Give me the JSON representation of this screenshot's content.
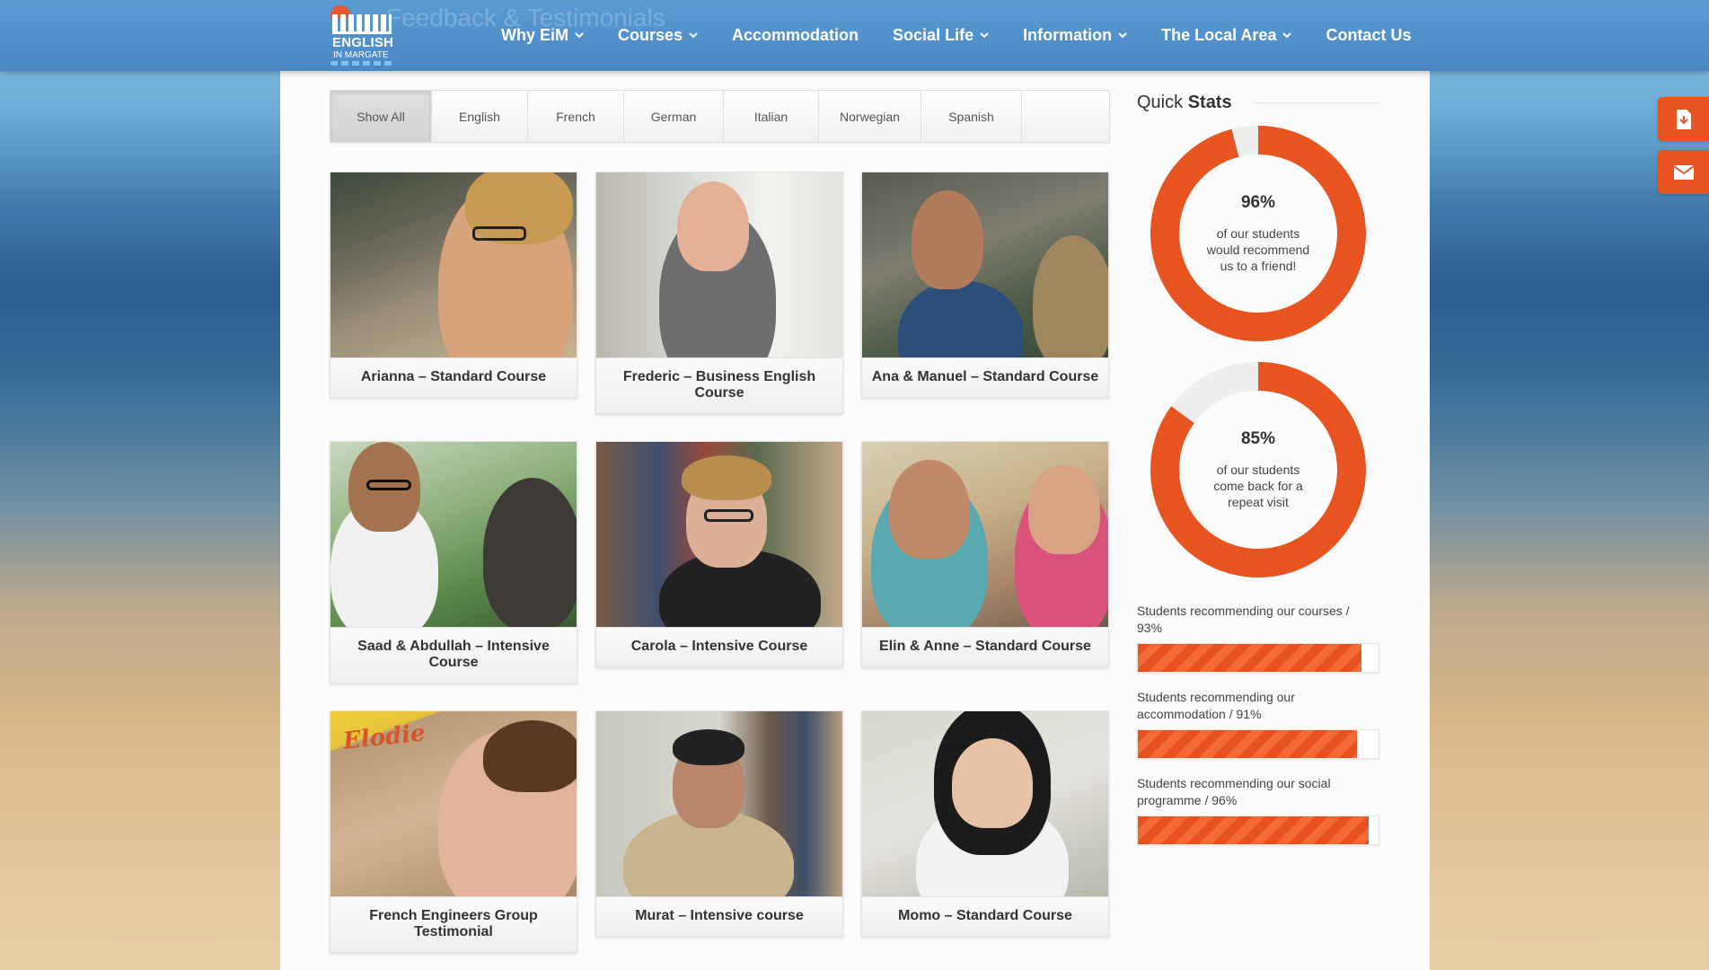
{
  "header": {
    "ghost_title": "Feedback & Testimonials",
    "logo": {
      "line1": "ENGLISH",
      "line2": "IN MARGATE"
    },
    "nav": [
      {
        "label": "Why EiM",
        "dropdown": true
      },
      {
        "label": "Courses",
        "dropdown": true
      },
      {
        "label": "Accommodation",
        "dropdown": false
      },
      {
        "label": "Social Life",
        "dropdown": true
      },
      {
        "label": "Information",
        "dropdown": true
      },
      {
        "label": "The Local Area",
        "dropdown": true
      },
      {
        "label": "Contact Us",
        "dropdown": false
      }
    ]
  },
  "filters": {
    "items": [
      "Show All",
      "English",
      "French",
      "German",
      "Italian",
      "Norwegian",
      "Spanish"
    ],
    "active": "Show All"
  },
  "testimonials": [
    {
      "title": "Arianna – Standard Course"
    },
    {
      "title": "Frederic – Business English Course"
    },
    {
      "title": "Ana & Manuel – Standard Course"
    },
    {
      "title": "Saad & Abdullah – Intensive Course"
    },
    {
      "title": "Carola – Intensive Course"
    },
    {
      "title": "Elin & Anne – Standard Course"
    },
    {
      "title": "French Engineers Group Testimonial",
      "thumb_banner": "Elodie"
    },
    {
      "title": "Murat – Intensive course"
    },
    {
      "title": "Momo – Standard Course"
    }
  ],
  "sidebar": {
    "title_plain": "Quick",
    "title_bold": "Stats",
    "donuts": [
      {
        "percent": "96%",
        "value": 96,
        "description": "of our students would recommend us to a friend!"
      },
      {
        "percent": "85%",
        "value": 85,
        "description": "of our students come back for a repeat visit"
      }
    ],
    "bars": [
      {
        "label": "Students recommending our courses / 93%",
        "value": 93
      },
      {
        "label": "Students recommending our accommodation / 91%",
        "value": 91
      },
      {
        "label": "Students recommending our social programme / 96%",
        "value": 96
      }
    ]
  },
  "colors": {
    "accent": "#e8541f",
    "nav_bg": "#4f8fc9",
    "donut_track": "#eeeeee"
  },
  "float_buttons": [
    {
      "icon": "download-icon"
    },
    {
      "icon": "envelope-icon"
    }
  ]
}
